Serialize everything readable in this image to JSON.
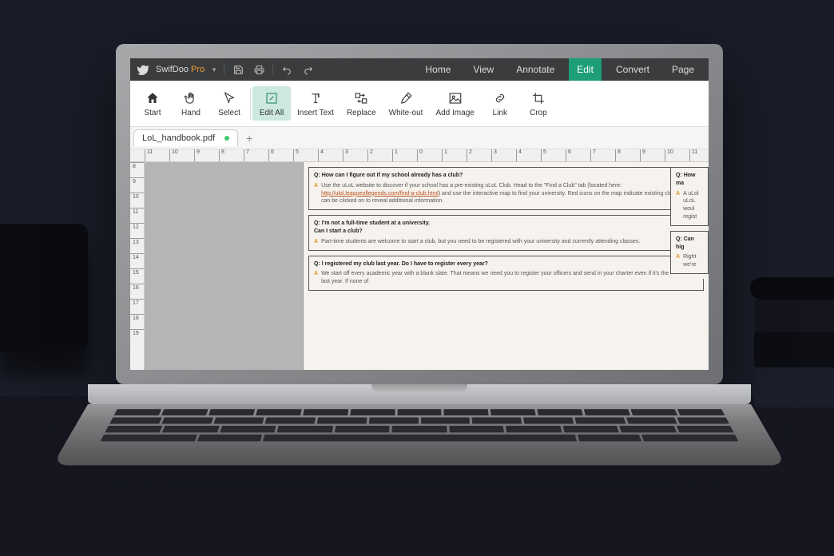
{
  "app": {
    "name": "SwifDoo",
    "edition": "Pro"
  },
  "menu": {
    "home": "Home",
    "view": "View",
    "annotate": "Annotate",
    "edit": "Edit",
    "convert": "Convert",
    "page": "Page",
    "active": "edit"
  },
  "ribbon": {
    "start": "Start",
    "hand": "Hand",
    "select": "Select",
    "edit_all": "Edit All",
    "insert_text": "Insert Text",
    "replace": "Replace",
    "white_out": "White-out",
    "add_image": "Add Image",
    "link": "Link",
    "crop": "Crop"
  },
  "tab": {
    "filename": "LoL_handbook.pdf"
  },
  "ruler": {
    "h": [
      "11",
      "10",
      "9",
      "8",
      "7",
      "6",
      "5",
      "4",
      "3",
      "2",
      "1",
      "0",
      "1",
      "2",
      "3",
      "4",
      "5",
      "6",
      "7",
      "8",
      "9",
      "10",
      "11"
    ],
    "v": [
      "8",
      "9",
      "10",
      "11",
      "12",
      "13",
      "14",
      "15",
      "16",
      "17",
      "18",
      "19"
    ]
  },
  "doc": {
    "qa1": {
      "q": "Q: How can I figure out if my school already has a club?",
      "a_pre": "Use the uLoL website to discover if your school has a pre-existing uLoL Club. Head to the \"Find a Club\" tab (located here: ",
      "a_link": "http://ulol.leagueoflegends.com/find-a-club.html",
      "a_post": ") and use the interactive map to find your university. Red icons on the map indicate existing clubs and can be clicked on to reveal additional information."
    },
    "qa2": {
      "q1": "Q: I'm not a full-time student at a university.",
      "q2": "Can I start a club?",
      "a": "Part-time students are welcome to start a club, but you need to be registered with your university and currently attending classes."
    },
    "qa3": {
      "q": "Q: I registered my club last year. Do I have to register every year?",
      "a": "We start off every academic year with a blank slate. That means we need you to register your officers and send in your charter even if it's the same as last year. If none of"
    },
    "side1": {
      "q": "Q: How ma",
      "a": "A uLol uLoL woul regist"
    },
    "side2": {
      "q": "Q: Can hig",
      "a": "Right we're"
    }
  }
}
